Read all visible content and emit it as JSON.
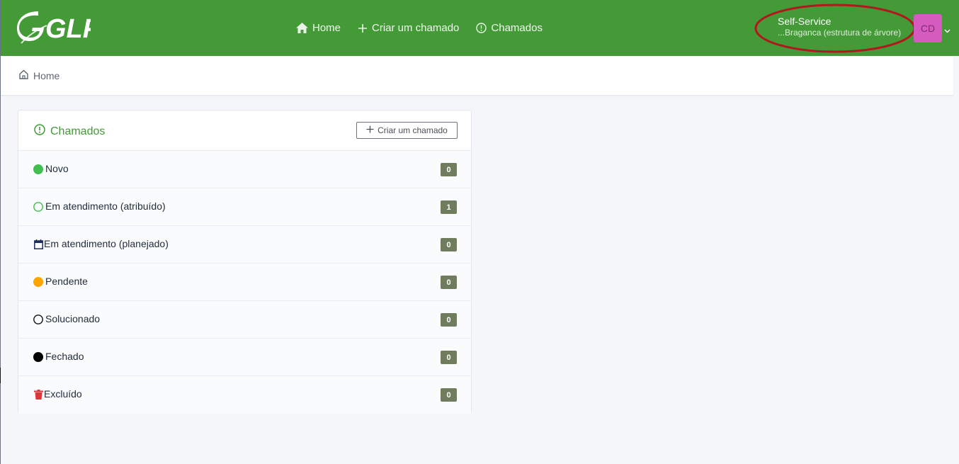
{
  "app": {
    "logo_text": "GLPI"
  },
  "nav": {
    "items": [
      {
        "label": "Home",
        "icon": "home-icon"
      },
      {
        "label": "Criar um chamado",
        "icon": "plus-icon"
      },
      {
        "label": "Chamados",
        "icon": "alert-circle-icon"
      }
    ]
  },
  "user": {
    "profile": "Self-Service",
    "entity": "...Braganca (estrutura de árvore)",
    "initials": "CD",
    "avatar_color": "#d65bbf"
  },
  "breadcrumb": {
    "label": "Home",
    "icon": "home-outline-icon"
  },
  "card": {
    "title": "Chamados",
    "title_icon": "alert-circle-icon",
    "create_button": "Criar um chamado",
    "statuses": [
      {
        "label": "Novo",
        "count": "0",
        "icon": "new-status-dot-icon",
        "color": "#3fbf4f"
      },
      {
        "label": "Em atendimento (atribuído)",
        "count": "1",
        "icon": "assigned-status-ring-icon",
        "color": "#3fbf4f"
      },
      {
        "label": "Em atendimento (planejado)",
        "count": "0",
        "icon": "calendar-icon",
        "color": "#1f2f5a"
      },
      {
        "label": "Pendente",
        "count": "0",
        "icon": "pending-status-dot-icon",
        "color": "#ffa500"
      },
      {
        "label": "Solucionado",
        "count": "0",
        "icon": "solved-status-ring-icon",
        "color": "#111111"
      },
      {
        "label": "Fechado",
        "count": "0",
        "icon": "closed-status-dot-icon",
        "color": "#000000"
      },
      {
        "label": "Excluído",
        "count": "0",
        "icon": "trash-icon",
        "color": "#d63939"
      }
    ]
  },
  "colors": {
    "brand_green": "#439a37",
    "badge": "#707c5e",
    "annotation_red": "#b0181e"
  }
}
